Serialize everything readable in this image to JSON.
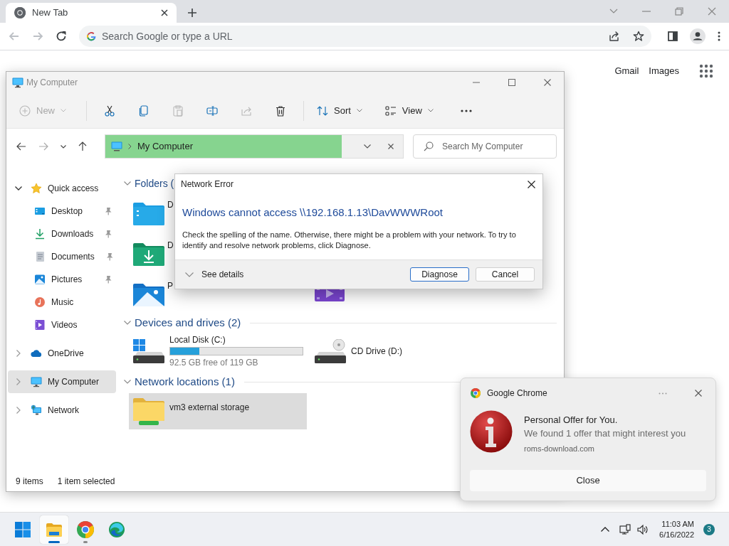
{
  "browser": {
    "tab": {
      "title": "New Tab",
      "selected": true
    },
    "omnibox": {
      "placeholder": "Search Google or type a URL"
    },
    "links": [
      "Gmail",
      "Images"
    ]
  },
  "explorer": {
    "title": "My Computer",
    "toolbar": [
      {
        "kind": "new",
        "label": "New",
        "disabled": true
      },
      {
        "kind": "cut",
        "disabled": false
      },
      {
        "kind": "copy",
        "disabled": false
      },
      {
        "kind": "paste",
        "disabled": true
      },
      {
        "kind": "rename",
        "disabled": false
      },
      {
        "kind": "share",
        "disabled": true
      },
      {
        "kind": "delete",
        "disabled": false
      },
      {
        "kind": "sort",
        "label": "Sort",
        "disabled": false
      },
      {
        "kind": "view",
        "label": "View",
        "disabled": false
      },
      {
        "kind": "more",
        "disabled": false
      }
    ],
    "address": {
      "path": "My Computer"
    },
    "search": {
      "placeholder": "Search My Computer"
    },
    "nav": [
      {
        "kind": "quick",
        "label": "Quick access",
        "expanded": true,
        "selected": false,
        "children": [
          {
            "kind": "desktop",
            "label": "Desktop",
            "pinned": true,
            "selected": false
          },
          {
            "kind": "downloads",
            "label": "Downloads",
            "pinned": true,
            "selected": false
          },
          {
            "kind": "documents",
            "label": "Documents",
            "pinned": true,
            "selected": false
          },
          {
            "kind": "pictures",
            "label": "Pictures",
            "pinned": true,
            "selected": false
          },
          {
            "kind": "music",
            "label": "Music",
            "pinned": false,
            "selected": false
          },
          {
            "kind": "videos",
            "label": "Videos",
            "pinned": false,
            "selected": false
          }
        ]
      },
      {
        "kind": "onedrive",
        "label": "OneDrive",
        "expanded": false,
        "selected": false
      },
      {
        "kind": "computer",
        "label": "My Computer",
        "expanded": false,
        "selected": true
      },
      {
        "kind": "network",
        "label": "Network",
        "expanded": false,
        "selected": false
      }
    ],
    "sections": [
      {
        "title": "Folders (",
        "expanded": true,
        "kind": "folders",
        "items": [
          {
            "kind": "desktop",
            "label": "D"
          },
          {
            "kind": "downloads",
            "label": "D"
          },
          {
            "kind": "pictures",
            "label": "P"
          },
          {
            "kind": "videos"
          }
        ]
      },
      {
        "title": "Devices and drives (2)",
        "expanded": true,
        "kind": "drives",
        "items": [
          {
            "kind": "disk",
            "label": "Local Disk (C:)",
            "level": 0.22,
            "detail": "92.5 GB free of 119 GB"
          },
          {
            "kind": "cd",
            "label": "CD Drive (D:)"
          }
        ]
      },
      {
        "title": "Network locations (1)",
        "expanded": true,
        "kind": "network",
        "items": [
          {
            "kind": "netfolder",
            "label": "vm3 external storage",
            "selected": true
          }
        ]
      }
    ],
    "status_bar": [
      "9 items",
      "1 item selected"
    ]
  },
  "dialog": {
    "title": "Network Error",
    "heading": "Windows cannot access \\\\192.168.1.13\\DavWWWRoot",
    "message": "Check the spelling of the name. Otherwise, there might be a problem with your network. To try to identify and resolve network problems, click Diagnose.",
    "details": "See details",
    "buttons": [
      {
        "label": "Diagnose",
        "default": true
      },
      {
        "label": "Cancel",
        "default": false
      }
    ]
  },
  "notification": {
    "app": "Google Chrome",
    "title": "Personal Offer for You.",
    "message": "We found 1 offer that might interest you",
    "source": "roms-download.com",
    "button": "Close"
  },
  "taskbar": {
    "apps": [
      {
        "kind": "start",
        "selected": false,
        "running": false
      },
      {
        "kind": "explorer",
        "selected": true,
        "running": true
      },
      {
        "kind": "chrome",
        "selected": false,
        "running": true
      },
      {
        "kind": "edge",
        "selected": false,
        "running": false
      }
    ],
    "time": "11:03 AM",
    "date": "6/16/2022",
    "badge": "3"
  }
}
